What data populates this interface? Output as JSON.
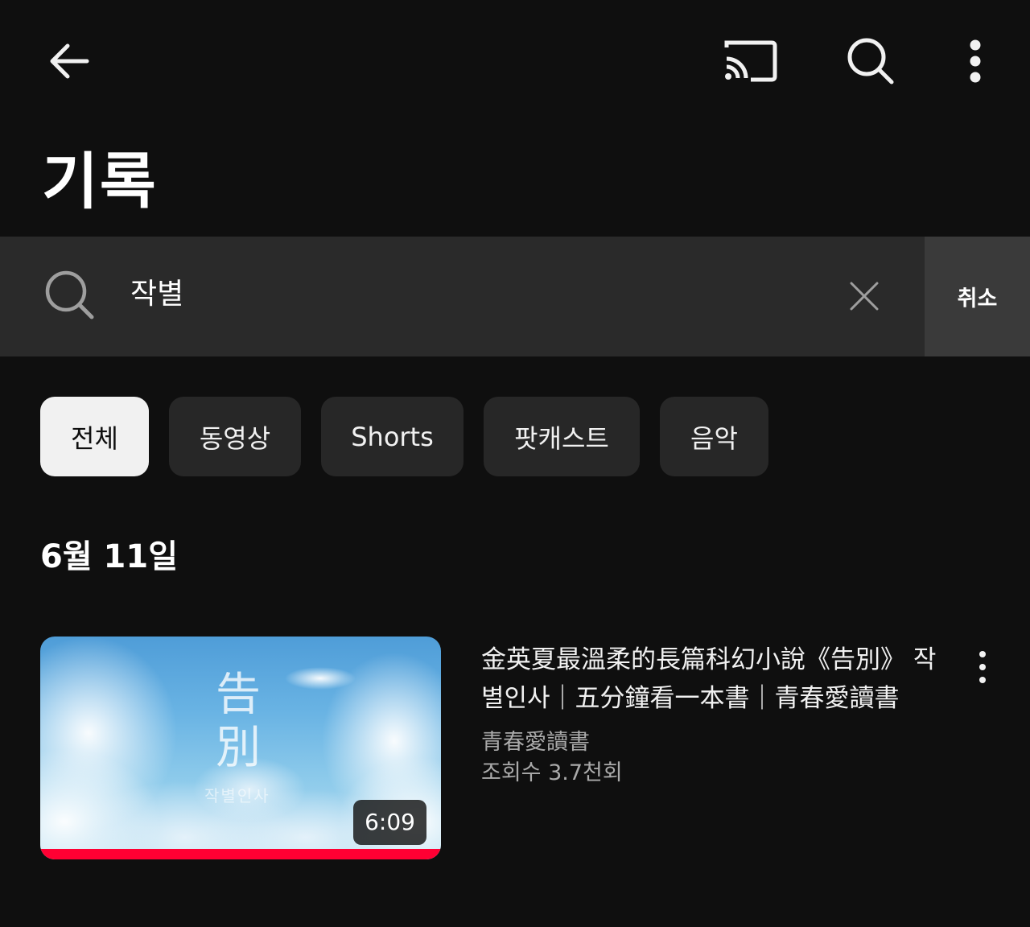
{
  "header": {
    "title": "기록",
    "icons": {
      "back": "arrow-left-icon",
      "cast": "cast-icon",
      "search": "search-icon",
      "more": "more-vert-icon"
    }
  },
  "search": {
    "value": "작별",
    "cancel_label": "취소"
  },
  "filters": {
    "chips": [
      {
        "label": "전체",
        "selected": true
      },
      {
        "label": "동영상",
        "selected": false
      },
      {
        "label": "Shorts",
        "selected": false
      },
      {
        "label": "팟캐스트",
        "selected": false
      },
      {
        "label": "음악",
        "selected": false
      }
    ]
  },
  "history": {
    "date_label": "6월 11일",
    "videos": [
      {
        "title": "金英夏最溫柔的長篇科幻小說《告別》 작별인사｜五分鐘看一本書｜青春愛讀書",
        "channel": "青春愛讀書",
        "views": "조회수 3.7천회",
        "duration": "6:09",
        "watched_fraction": 1.0,
        "thumbnail_text": {
          "chinese": "告別",
          "korean": "작별인사"
        }
      }
    ]
  },
  "colors": {
    "background": "#0f0f0f",
    "chip_bg": "#272727",
    "chip_selected_bg": "#f1f1f1",
    "search_bg": "#2a2a2a",
    "cancel_bg": "#3a3a3a",
    "progress": "#ff0033",
    "secondary_text": "#aaaaaa"
  }
}
